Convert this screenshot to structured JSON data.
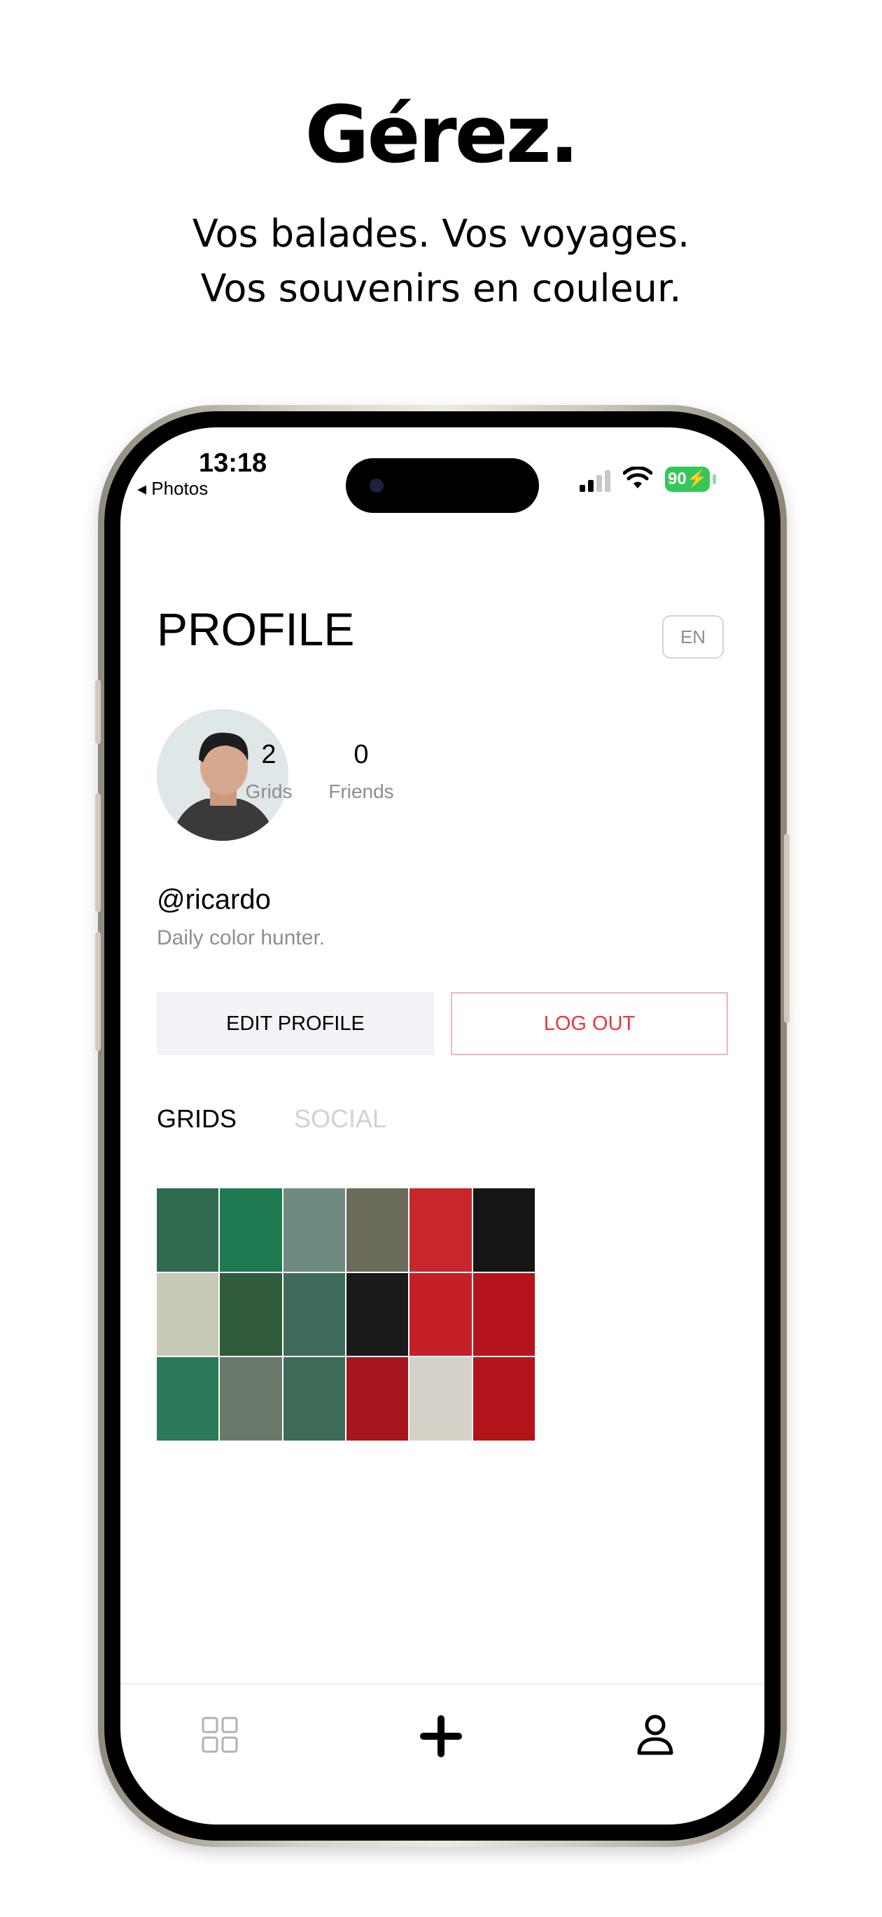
{
  "promo": {
    "headline": "Gérez.",
    "line1": "Vos balades. Vos voyages.",
    "line2": "Vos souvenirs en couleur."
  },
  "status_bar": {
    "time": "13:18",
    "back_label": "◂ Photos",
    "battery": "90"
  },
  "profile": {
    "title": "PROFILE",
    "language": "EN",
    "handle": "@ricardo",
    "bio": "Daily color hunter.",
    "stats": [
      {
        "value": "2",
        "label": "Grids"
      },
      {
        "value": "0",
        "label": "Friends"
      }
    ],
    "edit_label": "EDIT PROFILE",
    "logout_label": "LOG OUT"
  },
  "tabs": {
    "grids": "GRIDS",
    "social": "SOCIAL"
  },
  "grid_colors": [
    "#2f6a4f",
    "#1f7a52",
    "#6f8a80",
    "#6b6b5a",
    "#c8262c",
    "#151515",
    "#c9c9b8",
    "#2f5a3c",
    "#3f6b5a",
    "#1a1a1a",
    "#c51f27",
    "#b5141c",
    "#2b7a5a",
    "#6a7a6a",
    "#3d6b58",
    "#a8161d",
    "#d6d1c8",
    "#b3141c"
  ],
  "tab_bar": {
    "icons": [
      "grid-icon",
      "plus-icon",
      "person-icon"
    ]
  },
  "colors": {
    "logout_red": "#ef3340",
    "muted_gray": "#8e8e93",
    "battery_green": "#34c759"
  }
}
